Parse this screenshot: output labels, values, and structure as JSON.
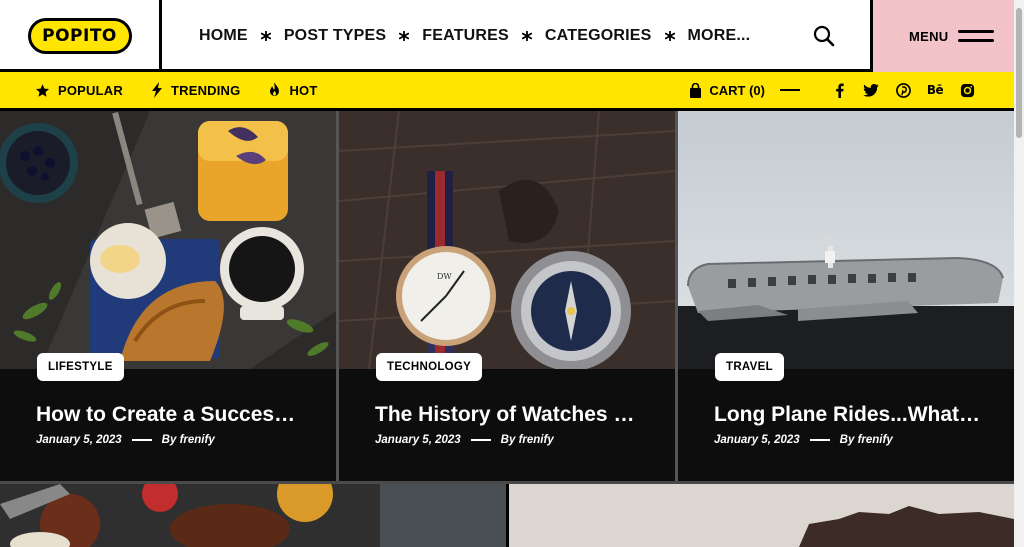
{
  "brand": {
    "logo_text": "POPITO",
    "accent": "#ffe500",
    "menu_bg": "#f2c3c8"
  },
  "nav": {
    "items": [
      {
        "label": "HOME"
      },
      {
        "label": "POST TYPES"
      },
      {
        "label": "FEATURES"
      },
      {
        "label": "CATEGORIES"
      },
      {
        "label": "MORE..."
      }
    ],
    "separator_icon": "asterisk-icon",
    "search_icon": "search-icon",
    "menu_label": "MENU",
    "menu_icon": "hamburger-icon"
  },
  "subbar": {
    "left": [
      {
        "label": "POPULAR",
        "icon": "star-icon"
      },
      {
        "label": "TRENDING",
        "icon": "bolt-icon"
      },
      {
        "label": "HOT",
        "icon": "flame-icon"
      }
    ],
    "cart_label": "CART (0)",
    "cart_icon": "bag-icon",
    "social": [
      "facebook-icon",
      "twitter-icon",
      "pinterest-icon",
      "behance-icon",
      "instagram-icon"
    ],
    "behance_text": "Bē"
  },
  "posts": [
    {
      "category": "LIFESTYLE",
      "title": "How to Create a Successful Morning Routine",
      "date": "January 5, 2023",
      "author": "By frenify"
    },
    {
      "category": "TECHNOLOGY",
      "title": "The History of Watches and Time",
      "date": "January 5, 2023",
      "author": "By frenify"
    },
    {
      "category": "TRAVEL",
      "title": "Long Plane Rides...What's Next",
      "date": "January 5, 2023",
      "author": "By frenify"
    }
  ]
}
